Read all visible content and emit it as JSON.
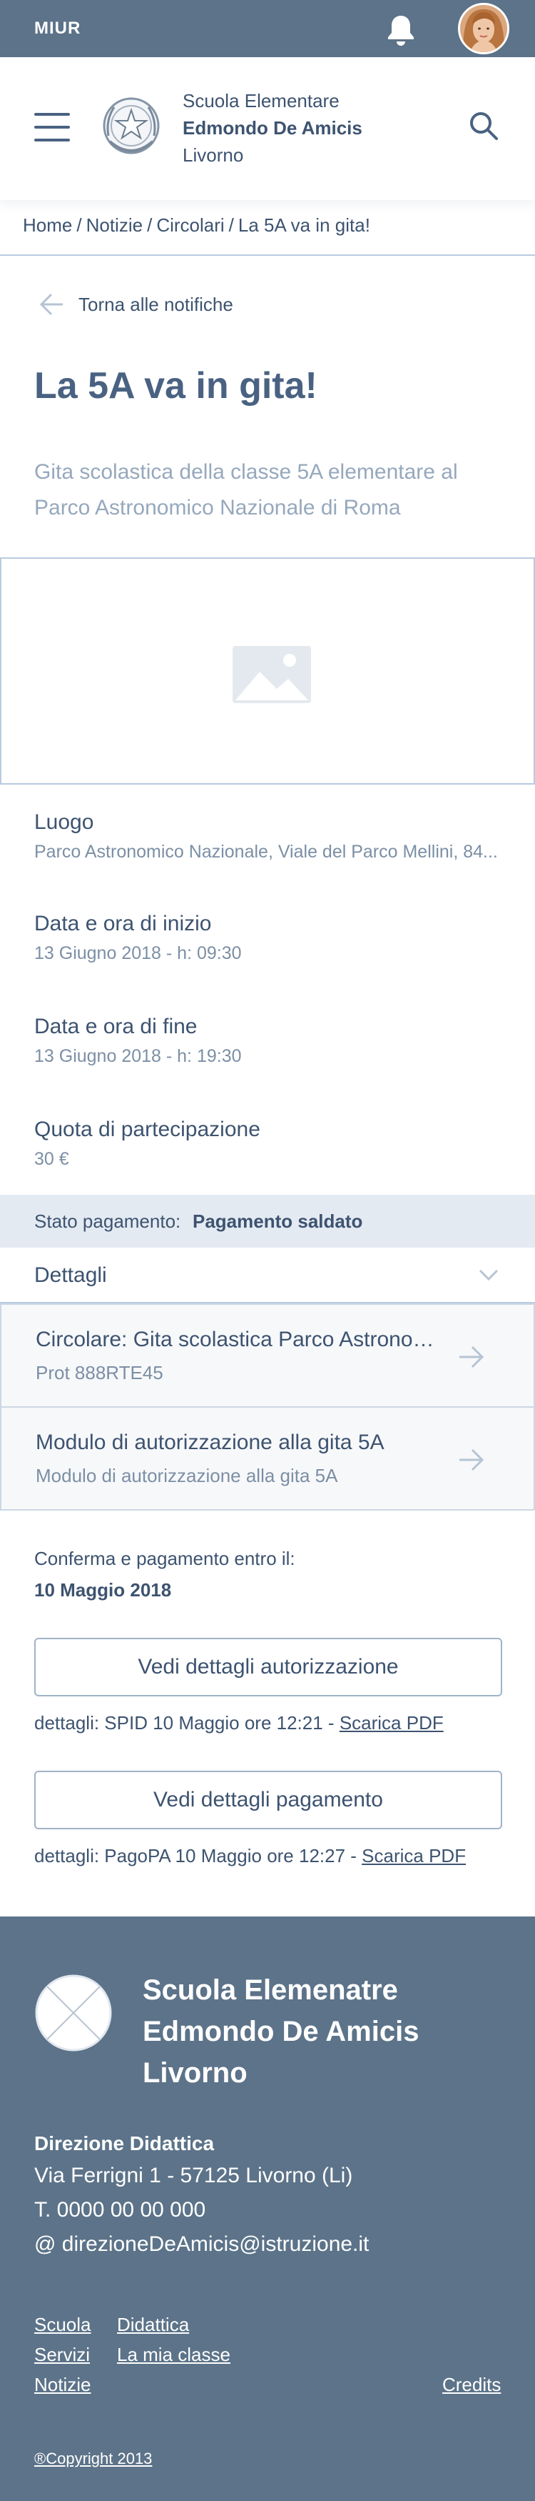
{
  "topbar": {
    "brand": "MIUR"
  },
  "header": {
    "school_line1": "Scuola Elementare",
    "school_line2": "Edmondo De Amicis",
    "school_line3": "Livorno"
  },
  "breadcrumb": [
    "Home",
    "Notizie",
    "Circolari",
    "La 5A va in gita!"
  ],
  "back_label": "Torna alle notifiche",
  "page": {
    "title": "La 5A va in gita!",
    "subtitle": "Gita scolastica della classe 5A elementare al Parco Astronomico Nazionale di Roma"
  },
  "fields": [
    {
      "label": "Luogo",
      "value": "Parco Astronomico Nazionale, Viale del Parco Mellini, 84..."
    },
    {
      "label": "Data e ora di inizio",
      "value": "13 Giugno 2018 - h: 09:30"
    },
    {
      "label": "Data e ora di fine",
      "value": "13 Giugno 2018 - h: 19:30"
    },
    {
      "label": "Quota di partecipazione",
      "value": "30 €"
    }
  ],
  "payment_status": {
    "label": "Stato pagamento:",
    "value": "Pagamento saldato"
  },
  "details": {
    "title": "Dettagli",
    "documents": [
      {
        "title": "Circolare: Gita scolastica Parco Astronomico Nazionale",
        "subtitle": "Prot 888RTE45"
      },
      {
        "title": "Modulo di autorizzazione alla gita 5A",
        "subtitle": "Modulo di autorizzazione alla gita 5A"
      }
    ]
  },
  "deadline": {
    "label": "Conferma e pagamento entro il:",
    "value": "10 Maggio 2018"
  },
  "authorization": {
    "button": "Vedi dettagli autorizzazione",
    "meta": "dettagli: SPID 10 Maggio ore 12:21 - ",
    "link": "Scarica PDF"
  },
  "payment": {
    "button": "Vedi dettagli pagamento",
    "meta": "dettagli: PagoPA 10 Maggio ore 12:27 - ",
    "link": "Scarica PDF"
  },
  "footer": {
    "name_line1": "Scuola Elemenatre",
    "name_line2": "Edmondo De Amicis",
    "name_line3": "Livorno",
    "direction": "Direzione Didattica",
    "address": "Via Ferrigni 1 - 57125 Livorno (Li)",
    "phone": "T. 0000 00 00 000",
    "email": "@ direzioneDeAmicis@istruzione.it",
    "links": [
      "Scuola",
      "Didattica",
      "Servizi",
      "La mia classe",
      "Notizie"
    ],
    "credits": "Credits",
    "copyright": "®Copyright 2013"
  },
  "colors": {
    "topbar": "#5c7389",
    "footer": "#5c7389",
    "primary_text": "#3d5370",
    "muted_text": "#96a8bc",
    "status_bg": "#e4eaf2",
    "divider": "#b9cbe0"
  }
}
